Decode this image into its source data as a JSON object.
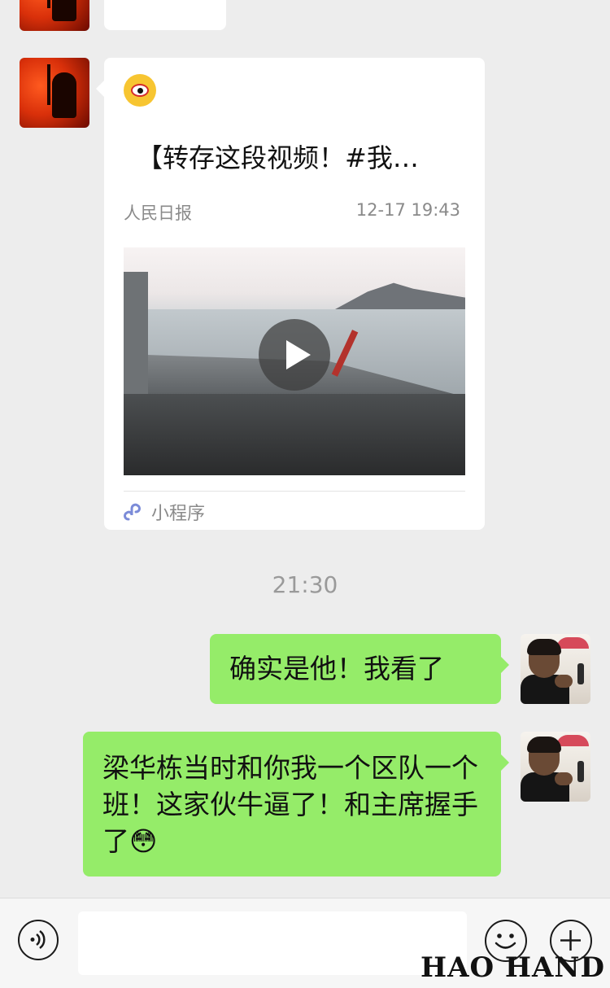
{
  "chat": {
    "top_partial_text": "",
    "shared_card": {
      "icon": "weibo-icon",
      "title": "【转存这段视频！#我…",
      "source": "人民日报",
      "time": "12-17 19:43",
      "video_icon": "play-icon",
      "mini_program_label": "小程序"
    },
    "timestamp": "21:30",
    "messages": [
      {
        "from": "me",
        "text": "确实是他！我看了"
      },
      {
        "from": "me",
        "text": "梁华栋当时和你我一个区队一个班！这家伙牛逼了！和主席握手了😳"
      }
    ]
  },
  "input_bar": {
    "voice_icon": "voice-icon",
    "text_value": "",
    "emoji_icon": "emoji-icon",
    "plus_icon": "plus-icon"
  },
  "watermark": "HAO HAND",
  "colors": {
    "background": "#ededed",
    "bubble_green": "#95ec69",
    "bubble_white": "#ffffff",
    "secondary_text": "#8a8a8a"
  }
}
